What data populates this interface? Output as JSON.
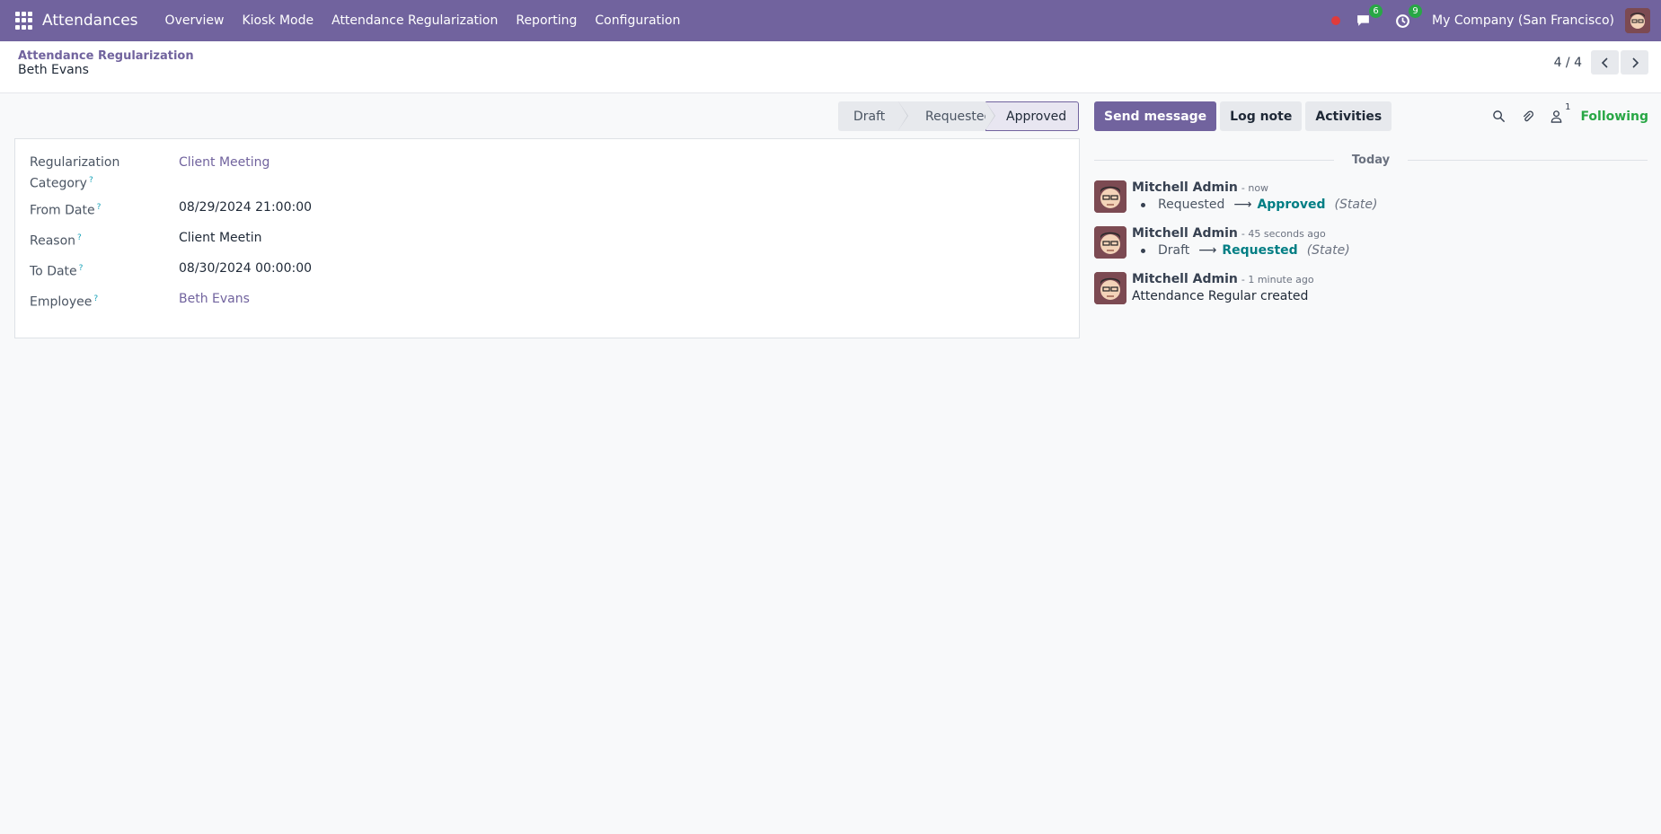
{
  "navbar": {
    "app_title": "Attendances",
    "menu": [
      "Overview",
      "Kiosk Mode",
      "Attendance Regularization",
      "Reporting",
      "Configuration"
    ],
    "messages_badge": "6",
    "activities_badge": "9",
    "company": "My Company (San Francisco)"
  },
  "control_panel": {
    "breadcrumb_parent": "Attendance Regularization",
    "breadcrumb_current": "Beth Evans",
    "pager_value": "4 / 4"
  },
  "statusbar": {
    "stages": [
      "Draft",
      "Requested",
      "Approved"
    ],
    "current": "Approved"
  },
  "form": {
    "fields": [
      {
        "label_line1": "Regularization",
        "label_line2": "Category",
        "value": "Client Meeting"
      },
      {
        "label": "From Date",
        "value": "08/29/2024 21:00:00"
      },
      {
        "label": "Reason",
        "value": "Client Meetin"
      },
      {
        "label": "To Date",
        "value": "08/30/2024 00:00:00"
      },
      {
        "label": "Employee",
        "value": "Beth Evans"
      }
    ],
    "help_mark": "?"
  },
  "chatter": {
    "buttons": {
      "send_message": "Send message",
      "log_note": "Log note",
      "activities": "Activities"
    },
    "follower_count": "1",
    "following_label": "Following",
    "day_separator": "Today",
    "messages": [
      {
        "author": "Mitchell Admin",
        "time": "- now",
        "old_value": "Requested",
        "new_value": "Approved",
        "field": "(State)"
      },
      {
        "author": "Mitchell Admin",
        "time": "- 45 seconds ago",
        "old_value": "Draft",
        "new_value": "Requested",
        "field": "(State)"
      },
      {
        "author": "Mitchell Admin",
        "time": "- 1 minute ago",
        "text": "Attendance Regular created"
      }
    ]
  },
  "colors": {
    "brand": "#71639e",
    "success": "#28a745",
    "tracking_new": "#017e84"
  }
}
